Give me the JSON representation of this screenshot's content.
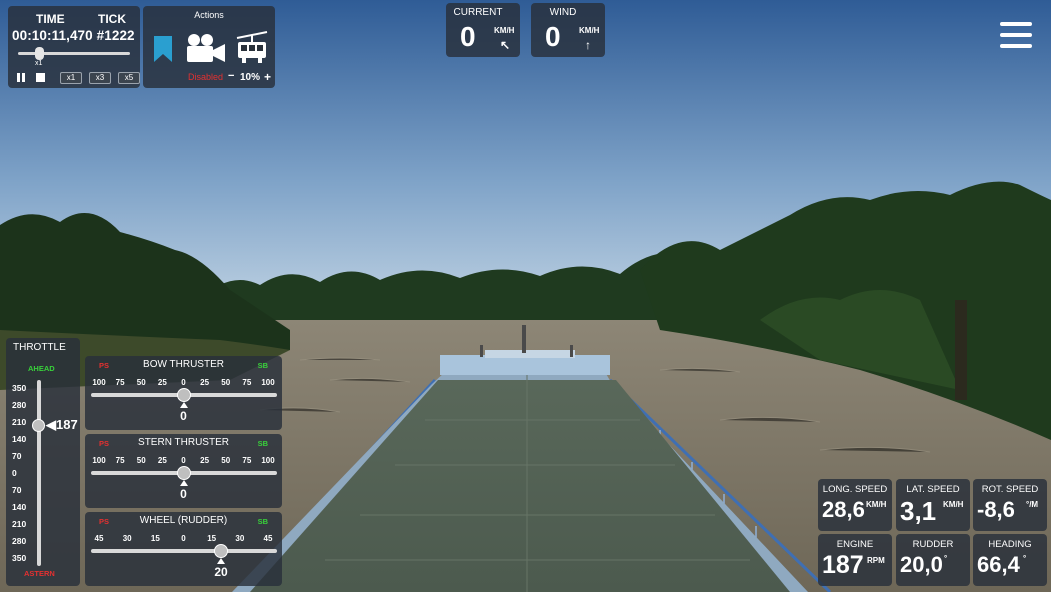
{
  "time_panel": {
    "time_label": "TIME",
    "tick_label": "TICK",
    "clock": "00:10:11,470 #1222",
    "multiplier": "x1",
    "speed_buttons": [
      "x1",
      "x3",
      "x5"
    ]
  },
  "actions_panel": {
    "title": "Actions",
    "status": "Disabled",
    "minus": "−",
    "percent": "10%",
    "plus": "+",
    "icons": [
      "bookmark-icon",
      "camera-icon",
      "tram-icon"
    ]
  },
  "current": {
    "title": "CURRENT",
    "value": "0",
    "unit": "KM/H",
    "arrow": "↖"
  },
  "wind": {
    "title": "WIND",
    "value": "0",
    "unit": "KM/H",
    "arrow": "↑"
  },
  "menu": {
    "icon": "hamburger-menu-icon"
  },
  "throttle": {
    "title": "THROTTLE",
    "ahead": "AHEAD",
    "astern": "ASTERN",
    "ticks": [
      "350",
      "280",
      "210",
      "140",
      "70",
      "0",
      "70",
      "140",
      "210",
      "280",
      "350"
    ],
    "value": "187",
    "level": 187,
    "max": 350
  },
  "bow_thruster": {
    "title": "BOW THRUSTER",
    "ps": "PS",
    "sb": "SB",
    "scale": [
      "100",
      "75",
      "50",
      "25",
      "0",
      "25",
      "50",
      "75",
      "100"
    ],
    "value": "0",
    "level": 0,
    "max": 100
  },
  "stern_thruster": {
    "title": "STERN THRUSTER",
    "ps": "PS",
    "sb": "SB",
    "scale": [
      "100",
      "75",
      "50",
      "25",
      "0",
      "25",
      "50",
      "75",
      "100"
    ],
    "value": "0",
    "level": 0,
    "max": 100
  },
  "wheel": {
    "title": "WHEEL (RUDDER)",
    "ps": "PS",
    "sb": "SB",
    "scale": [
      "45",
      "30",
      "15",
      "0",
      "15",
      "30",
      "45"
    ],
    "value": "20",
    "level": 20,
    "max": 45
  },
  "stats": {
    "long_speed": {
      "title": "LONG. SPEED",
      "value": "28,6",
      "unit": "KM/H"
    },
    "lat_speed": {
      "title": "LAT. SPEED",
      "value": "3,1",
      "unit": "KM/H"
    },
    "rot_speed": {
      "title": "ROT. SPEED",
      "value": "-8,6",
      "unit": "°/M"
    },
    "engine": {
      "title": "ENGINE",
      "value": "187",
      "unit": "RPM"
    },
    "rudder": {
      "title": "RUDDER",
      "value": "20,0",
      "unit": "°"
    },
    "heading": {
      "title": "HEADING",
      "value": "66,4",
      "unit": "°"
    }
  },
  "colors": {
    "panel": "#28303a",
    "ahead": "#38d13a",
    "astern": "#e53030",
    "bookmark": "#2a9fd0"
  }
}
